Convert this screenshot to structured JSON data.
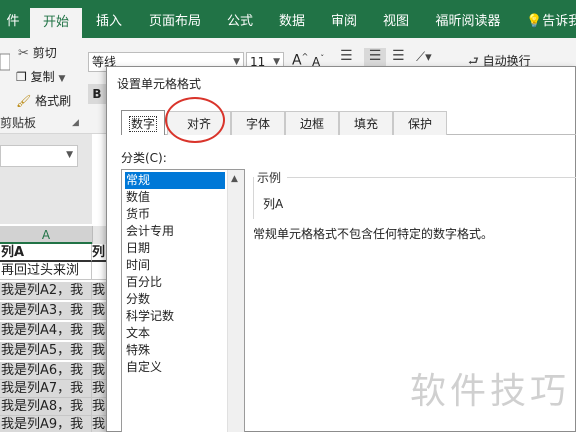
{
  "ribbon_tabs": {
    "file": "件",
    "home": "开始",
    "insert": "插入",
    "layout": "页面布局",
    "formula": "公式",
    "data": "数据",
    "review": "审阅",
    "view": "视图",
    "foxit": "福昕阅读器",
    "tell": "告诉我"
  },
  "ribbon": {
    "cut": "剪切",
    "copy": "复制",
    "format_painter": "格式刷",
    "clipboard_group": "剪贴板",
    "font_name": "等线",
    "font_size": "11",
    "bold": "B",
    "wrap_text": "自动换行"
  },
  "sheet": {
    "column_a": "A",
    "rows": [
      {
        "a": "列A",
        "b": "列"
      },
      {
        "a": "再回过头来浏",
        "b": ""
      },
      {
        "a": "我是列A2，我",
        "b": "我"
      },
      {
        "a": "我是列A3，我",
        "b": "我"
      },
      {
        "a": "我是列A4，我",
        "b": "我"
      },
      {
        "a": "我是列A5，我",
        "b": "我"
      },
      {
        "a": "我是列A6，我",
        "b": "我"
      },
      {
        "a": "我是列A7，我",
        "b": "我"
      },
      {
        "a": "我是列A8，我",
        "b": "我"
      },
      {
        "a": "我是列A9，我",
        "b": "我"
      }
    ]
  },
  "dialog": {
    "title": "设置单元格格式",
    "tabs": [
      "数字",
      "对齐",
      "字体",
      "边框",
      "填充",
      "保护"
    ],
    "active_tab": "数字",
    "highlighted_tab": "对齐",
    "category_label": "分类(C):",
    "categories": [
      "常规",
      "数值",
      "货币",
      "会计专用",
      "日期",
      "时间",
      "百分比",
      "分数",
      "科学记数",
      "文本",
      "特殊",
      "自定义"
    ],
    "selected_category": "常规",
    "sample_label": "示例",
    "sample_value": "列A",
    "description": "常规单元格格式不包含任何特定的数字格式。"
  },
  "watermark": "软件技巧",
  "colors": {
    "excel_green": "#217346",
    "selection_blue": "#0078d7",
    "highlight_circle": "#d9342b"
  }
}
